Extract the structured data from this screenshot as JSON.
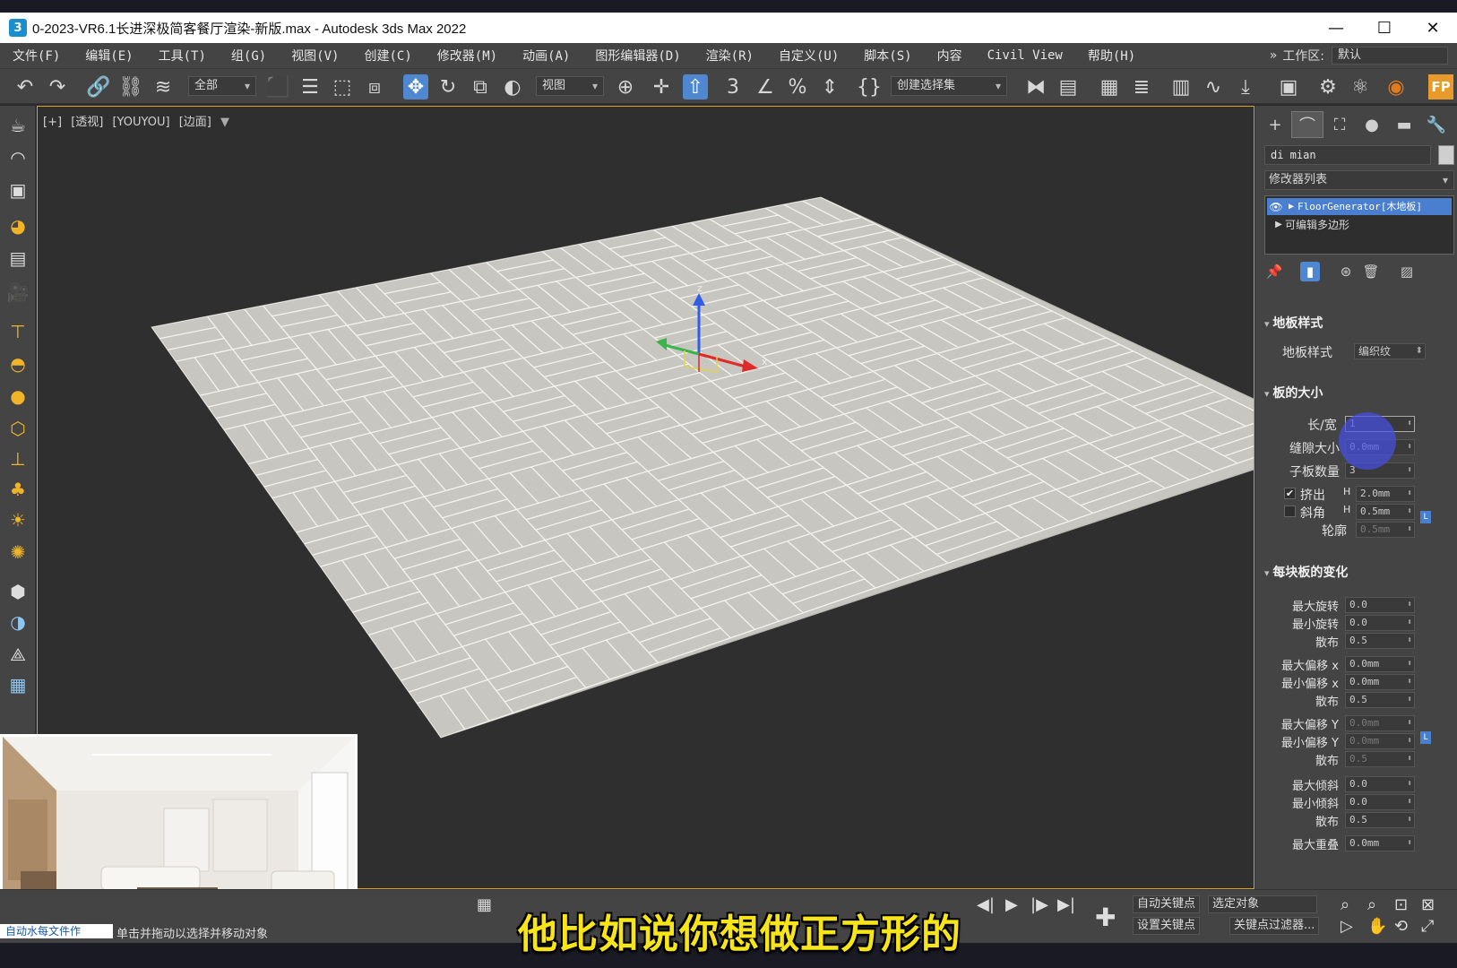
{
  "window": {
    "title": "0-2023-VR6.1长进深极简客餐厅渲染-新版.max - Autodesk 3ds Max 2022",
    "app_icon": "3",
    "minimize": "—",
    "maximize": "☐",
    "close": "✕"
  },
  "menu": [
    "文件(F)",
    "编辑(E)",
    "工具(T)",
    "组(G)",
    "视图(V)",
    "创建(C)",
    "修改器(M)",
    "动画(A)",
    "图形编辑器(D)",
    "渲染(R)",
    "自定义(U)",
    "脚本(S)",
    "内容",
    "Civil View",
    "帮助(H)"
  ],
  "workspace": {
    "expand": "»",
    "label": "工作区:",
    "value": "默认"
  },
  "toolbar": {
    "selection_filter": "全部",
    "ref_coord": "视图",
    "named_selection": "创建选择集",
    "fp_badge": "FP"
  },
  "viewport": {
    "labels": [
      "[+]",
      "[透视]",
      "[YOUYOU]",
      "[边面]"
    ],
    "filter_icon": "▼",
    "gizmo_z": "z",
    "gizmo_x": "x"
  },
  "command_panel": {
    "object_name": "di mian",
    "modifier_list": "修改器列表",
    "stack": [
      {
        "label": "FloorGenerator[木地板]",
        "selected": true
      },
      {
        "label": "可编辑多边形",
        "selected": false
      }
    ],
    "rollouts": {
      "floor_style": {
        "title": "地板样式",
        "style_label": "地板样式",
        "style_value": "编织纹"
      },
      "board_size": {
        "title": "板的大小",
        "ratio_label": "长/宽",
        "ratio_value": "1",
        "gap_label": "缝隙大小",
        "gap_value": "0.0mm",
        "sub_label": "子板数量",
        "sub_value": "3",
        "extrude_label": "挤出",
        "extrude_h": "H",
        "extrude_value": "2.0mm",
        "extrude_checked": "✔",
        "bevel_label": "斜角",
        "bevel_h": "H",
        "bevel_value": "0.5mm",
        "contour_label": "轮廓",
        "contour_value": "0.5mm",
        "lock": "L"
      },
      "variation": {
        "title": "每块板的变化",
        "rows": [
          {
            "label": "最大旋转",
            "value": "0.0",
            "disabled": false
          },
          {
            "label": "最小旋转",
            "value": "0.0",
            "disabled": false
          },
          {
            "label": "散布",
            "value": "0.5",
            "disabled": false
          },
          {
            "label": "最大偏移 x",
            "value": "0.0mm",
            "disabled": false
          },
          {
            "label": "最小偏移 x",
            "value": "0.0mm",
            "disabled": false
          },
          {
            "label": "散布",
            "value": "0.5",
            "disabled": false
          },
          {
            "label": "最大偏移 Y",
            "value": "0.0mm",
            "disabled": true
          },
          {
            "label": "最小偏移 Y",
            "value": "0.0mm",
            "disabled": true
          },
          {
            "label": "散布",
            "value": "0.5",
            "disabled": true
          },
          {
            "label": "最大倾斜",
            "value": "0.0",
            "disabled": false
          },
          {
            "label": "最小倾斜",
            "value": "0.0",
            "disabled": false
          },
          {
            "label": "散布",
            "value": "0.5",
            "disabled": false
          },
          {
            "label": "最大重叠",
            "value": "0.0mm",
            "disabled": false
          }
        ]
      }
    }
  },
  "status": {
    "left_badge": "自动水每文件作",
    "prompt": "单击并拖动以选择并移动对象"
  },
  "animation": {
    "auto_key": "自动关键点",
    "set_key": "设置关键点",
    "selected": "选定对象",
    "key_filters": "关键点过滤器..."
  },
  "subtitle": "他比如说你想做正方形的",
  "colors": {
    "ui_panel": "#444444",
    "viewport_bg": "#2f2f2f",
    "active_border": "#d9a528",
    "accent": "#4f88d0",
    "floor": "#c8c6c1",
    "subtitle": "#f7e51a"
  }
}
